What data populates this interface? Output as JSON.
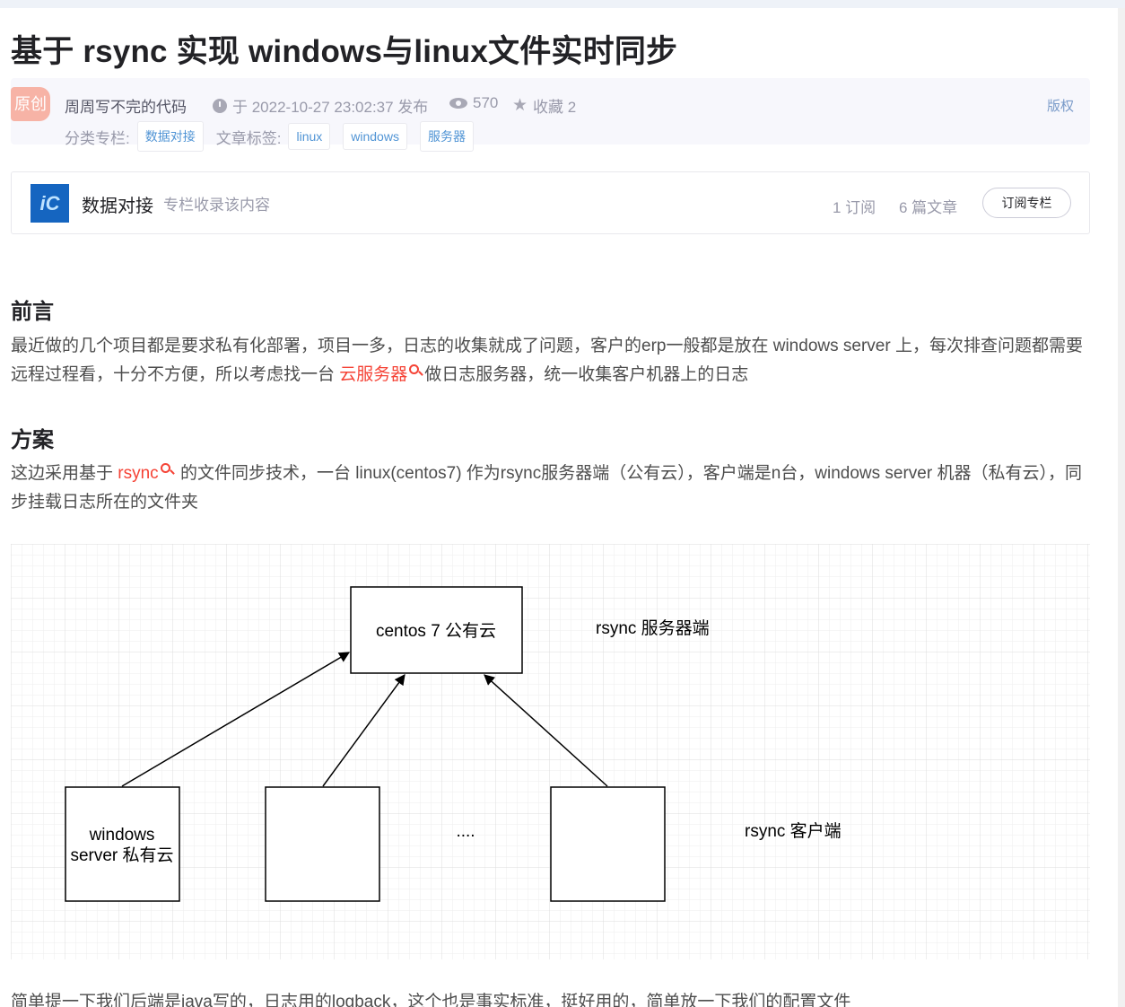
{
  "article": {
    "title": "基于 rsync 实现 windows与linux文件实时同步",
    "badge": "原创",
    "author": "周周写不完的代码",
    "published": "于 2022-10-27 23:02:37 发布",
    "views": "570",
    "favorites": "收藏 2",
    "copyright": "版权",
    "category_label": "分类专栏:",
    "category": "数据对接",
    "tags_label": "文章标签:",
    "tags": [
      "linux",
      "windows",
      "服务器"
    ]
  },
  "column": {
    "logo_text": "iC",
    "name": "数据对接",
    "desc": "专栏收录该内容",
    "subs": "1 订阅",
    "articles": "6 篇文章",
    "subscribe": "订阅专栏"
  },
  "content": {
    "h_preface": "前言",
    "p1_a": "最近做的几个项目都是要求私有化部署，项目一多，日志的收集就成了问题，客户的erp一般都是放在 windows server 上，每次排查问题都需要远程过程看，十分不方便，所以考虑找一台 ",
    "p1_link": "云服务器",
    "p1_b": "做日志服务器，统一收集客户机器上的日志",
    "h_plan": "方案",
    "p2_a": "这边采用基于 ",
    "p2_link": "rsync",
    "p2_b": " 的文件同步技术，一台 linux(centos7) 作为rsync服务器端（公有云），客户端是n台，windows server 机器（私有云），同步挂载日志所在的文件夹",
    "p3": "简单提一下我们后端是java写的，日志用的logback，这个也是事实标准，挺好用的，简单放一下我们的配置文件"
  },
  "diagram": {
    "server_box": "centos 7 公有云",
    "server_label": "rsync 服务器端",
    "client1_line1": "windows",
    "client1_line2": "server 私有云",
    "ellipsis": "....",
    "client_label": "rsync 客户端"
  },
  "colors": {
    "link": "#f54336",
    "tag": "#5094d5",
    "badge": "#f7b3a6"
  }
}
